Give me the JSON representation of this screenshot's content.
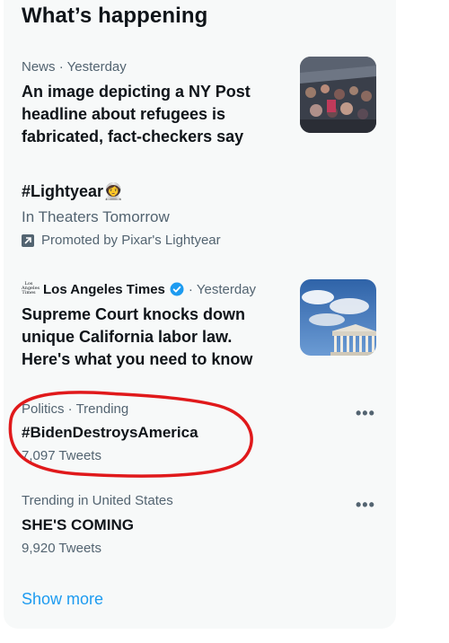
{
  "section_title": "What’s happening",
  "items": [
    {
      "category": "News",
      "separator": "·",
      "time": "Yesterday",
      "headline_lines": [
        "An image depicting a NY Post",
        "headline about refugees is",
        "fabricated, fact-checkers say"
      ]
    },
    {
      "hashtag": "#Lightyear",
      "emoji": "👩‍🚀",
      "subtitle": "In Theaters Tomorrow",
      "promoted": "Promoted by Pixar's Lightyear"
    },
    {
      "logo_text": "Los Angeles Times",
      "source": "Los Angeles Times",
      "separator": "·",
      "time": "Yesterday",
      "headline_lines": [
        "Supreme Court knocks down",
        "unique California labor law.",
        "Here's what you need to know"
      ]
    },
    {
      "context": "Politics · Trending",
      "trend": "#BidenDestroysAmerica",
      "count": "7,097 Tweets",
      "more": "•••"
    },
    {
      "context": "Trending in United States",
      "trend": "SHE'S COMING",
      "count": "9,920 Tweets",
      "more": "•••"
    }
  ],
  "show_more": "Show more",
  "colors": {
    "panel_bg": "#f7f9f9",
    "text_primary": "#0f1419",
    "text_secondary": "#536471",
    "link": "#1d9bf0",
    "annotation": "#e0191b"
  },
  "icons": {
    "promoted": "promoted-arrow-icon",
    "verified": "verified-badge-icon",
    "more": "more-options-icon"
  }
}
